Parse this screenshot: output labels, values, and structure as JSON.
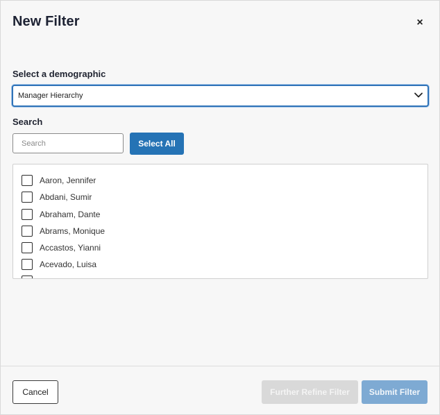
{
  "dialog": {
    "title": "New Filter",
    "close_glyph": "×"
  },
  "demographic": {
    "label": "Select a demographic",
    "selected_value": "Manager Hierarchy"
  },
  "search": {
    "label": "Search",
    "placeholder": "Search",
    "select_all_label": "Select All"
  },
  "list": {
    "items": [
      {
        "label": "Aaron, Jennifer",
        "checked": false
      },
      {
        "label": "Abdani, Sumir",
        "checked": false
      },
      {
        "label": "Abraham, Dante",
        "checked": false
      },
      {
        "label": "Abrams, Monique",
        "checked": false
      },
      {
        "label": "Accastos, Yianni",
        "checked": false
      },
      {
        "label": "Acevado, Luisa",
        "checked": false
      }
    ]
  },
  "footer": {
    "cancel_label": "Cancel",
    "refine_label": "Further Refine Filter",
    "submit_label": "Submit Filter"
  },
  "colors": {
    "accent": "#2573b5",
    "submit_disabled": "#7eaad3",
    "refine_disabled": "#d9d9d9"
  }
}
